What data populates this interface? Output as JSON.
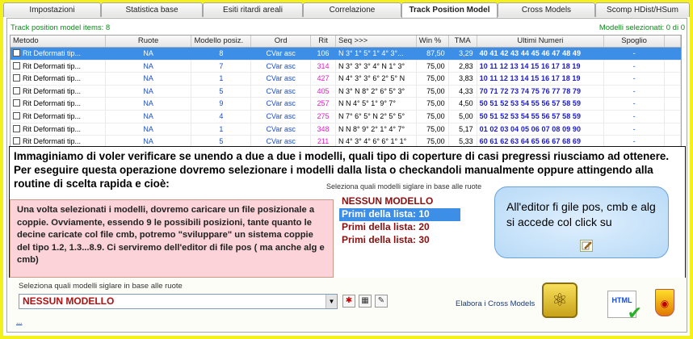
{
  "tabs": [
    {
      "label": "Impostazioni",
      "active": false
    },
    {
      "label": "Statistica base",
      "active": false
    },
    {
      "label": "Esiti ritardi areali",
      "active": false
    },
    {
      "label": "Correlazione",
      "active": false
    },
    {
      "label": "Track Position Model",
      "active": true
    },
    {
      "label": "Cross Models",
      "active": false
    },
    {
      "label": "Scomp HDist/HSum",
      "active": false
    }
  ],
  "info": {
    "items_label": "Track position model items: 8",
    "selected_label": "Modelli selezionati: 0 di 0"
  },
  "grid": {
    "headers": [
      "Metodo",
      "Ruote",
      "Modello posiz.",
      "Ord",
      "Rit",
      "Seq >>>",
      "Win %",
      "TMA",
      "Ultimi Numeri",
      "Spoglio"
    ],
    "rows": [
      {
        "metodo": "Rit Deformati tip...",
        "ruote": "NA",
        "modello": "8",
        "ord": "CVar asc",
        "rit": "106",
        "seq": "N 3° 1° 5° 1° 4° 3°...",
        "win": "87,50",
        "tma": "3,29",
        "ultimi": "40 41 42 43 44 45 46 47 48 49",
        "spoglio": "-",
        "selected": true
      },
      {
        "metodo": "Rit Deformati tip...",
        "ruote": "NA",
        "modello": "7",
        "ord": "CVar asc",
        "rit": "314",
        "seq": "N 3° 3° 3° 4° N 1° 3°",
        "win": "75,00",
        "tma": "2,83",
        "ultimi": "10 11 12 13 14 15 16 17 18 19",
        "spoglio": "-",
        "selected": false
      },
      {
        "metodo": "Rit Deformati tip...",
        "ruote": "NA",
        "modello": "1",
        "ord": "CVar asc",
        "rit": "427",
        "seq": "N 4° 3° 3° 6° 2° 5° N",
        "win": "75,00",
        "tma": "3,83",
        "ultimi": "10 11 12 13 14 15 16 17 18 19",
        "spoglio": "-",
        "selected": false
      },
      {
        "metodo": "Rit Deformati tip...",
        "ruote": "NA",
        "modello": "5",
        "ord": "CVar asc",
        "rit": "405",
        "seq": "N 3° N 8° 2° 6° 5° 3°",
        "win": "75,00",
        "tma": "4,33",
        "ultimi": "70 71 72 73 74 75 76 77 78 79",
        "spoglio": "-",
        "selected": false
      },
      {
        "metodo": "Rit Deformati tip...",
        "ruote": "NA",
        "modello": "9",
        "ord": "CVar asc",
        "rit": "257",
        "seq": "N N 4° 5° 1° 9° 7°",
        "win": "75,00",
        "tma": "4,50",
        "ultimi": "50 51 52 53 54 55 56 57 58 59",
        "spoglio": "-",
        "selected": false
      },
      {
        "metodo": "Rit Deformati tip...",
        "ruote": "NA",
        "modello": "4",
        "ord": "CVar asc",
        "rit": "275",
        "seq": "N 7° 6° 5° N 2° 5° 5°",
        "win": "75,00",
        "tma": "5,00",
        "ultimi": "50 51 52 53 54 55 56 57 58 59",
        "spoglio": "-",
        "selected": false
      },
      {
        "metodo": "Rit Deformati tip...",
        "ruote": "NA",
        "modello": "1",
        "ord": "CVar asc",
        "rit": "348",
        "seq": "N N 8° 9° 2° 1° 4° 7°",
        "win": "75,00",
        "tma": "5,17",
        "ultimi": "01 02 03 04 05 06 07 08 09 90",
        "spoglio": "-",
        "selected": false
      },
      {
        "metodo": "Rit Deformati tip...",
        "ruote": "NA",
        "modello": "5",
        "ord": "CVar asc",
        "rit": "211",
        "seq": "N 4° 3° 4° 6° 6° 1° 1°",
        "win": "75,00",
        "tma": "5,33",
        "ultimi": "60 61 62 63 64 65 66 67 68 69",
        "spoglio": "-",
        "selected": false
      }
    ]
  },
  "note_main": "Immaginiamo di voler verificare se unendo a due a due i modelli, quali tipo di coperture di casi pregressi riusciamo ad ottenere. Per eseguire questa operazione dovremo selezionare i modelli dalla lista o checkandoli manualmente oppure attingendo alla routine di scelta rapida e cioè:",
  "note_pink": "Una volta selezionati i modelli, dovremo caricare un file posizionale a coppie. Ovviamente, essendo 9 le possibili posizioni, tante quanto le decine caricate col file cmb, potremo \"sviluppare\" un sistema  coppie del tipo 1.2, 1.3...8.9. Ci serviremo dell'editor di file pos ( ma anche alg e cmb)",
  "dropdown_label": "Seleziona quali modelli siglare in base alle ruote",
  "quick_list": [
    "NESSUN MODELLO",
    "Primi della lista: 10",
    "Primi della lista: 20",
    "Primi della lista: 30"
  ],
  "bubble_text": "All'editor fi gile pos, cmb e alg si accede col click su",
  "bottom": {
    "label": "Seleziona quali modelli siglare in base alle ruote",
    "combo_value": "NESSUN MODELLO",
    "elabora_label": "Elabora i Cross Models",
    "html_label": "HTML",
    "dots": "..."
  },
  "colors": {
    "frame": "#f4f01a",
    "selection": "#3d8ee6",
    "pink_note": "#fbd3d8",
    "list_text": "#8a0f0f"
  }
}
